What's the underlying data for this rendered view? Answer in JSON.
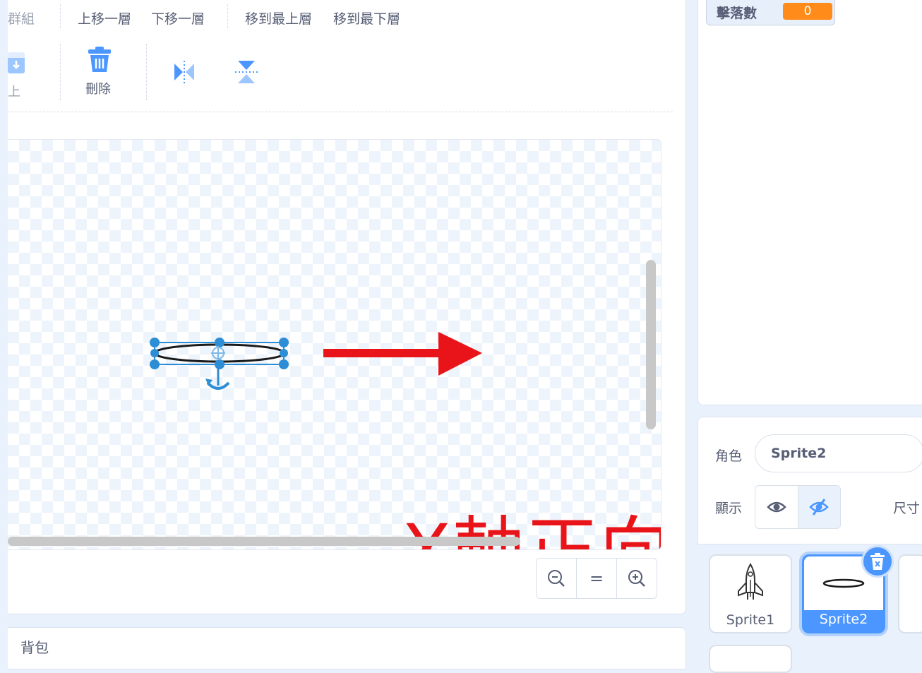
{
  "toolbar": {
    "ungroup_label": "群組",
    "forward_label": "上移一層",
    "backward_label": "下移一層",
    "front_label": "移到最上層",
    "back_label": "移到最下層",
    "paste_label": "上",
    "delete_label": "刪除",
    "flip_h_icon": "flip-horizontal-icon",
    "flip_v_icon": "flip-vertical-icon"
  },
  "annotation": {
    "text": "X軸正向",
    "color": "#e8141a"
  },
  "zoom": {
    "out_icon": "zoom-out-icon",
    "reset_label": "=",
    "in_icon": "zoom-in-icon"
  },
  "backpack": {
    "label": "背包"
  },
  "monitor": {
    "label": "擊落數",
    "value": "0",
    "color": "#ff8c1a"
  },
  "sprite_info": {
    "sprite_label": "角色",
    "sprite_name": "Sprite2",
    "show_label": "顯示",
    "size_label": "尺寸",
    "accent": "#4c97ff"
  },
  "sprites": [
    {
      "name": "Sprite1",
      "icon": "rocket-sprite-icon",
      "selected": false
    },
    {
      "name": "Sprite2",
      "icon": "ellipse-sprite-icon",
      "selected": true
    }
  ]
}
